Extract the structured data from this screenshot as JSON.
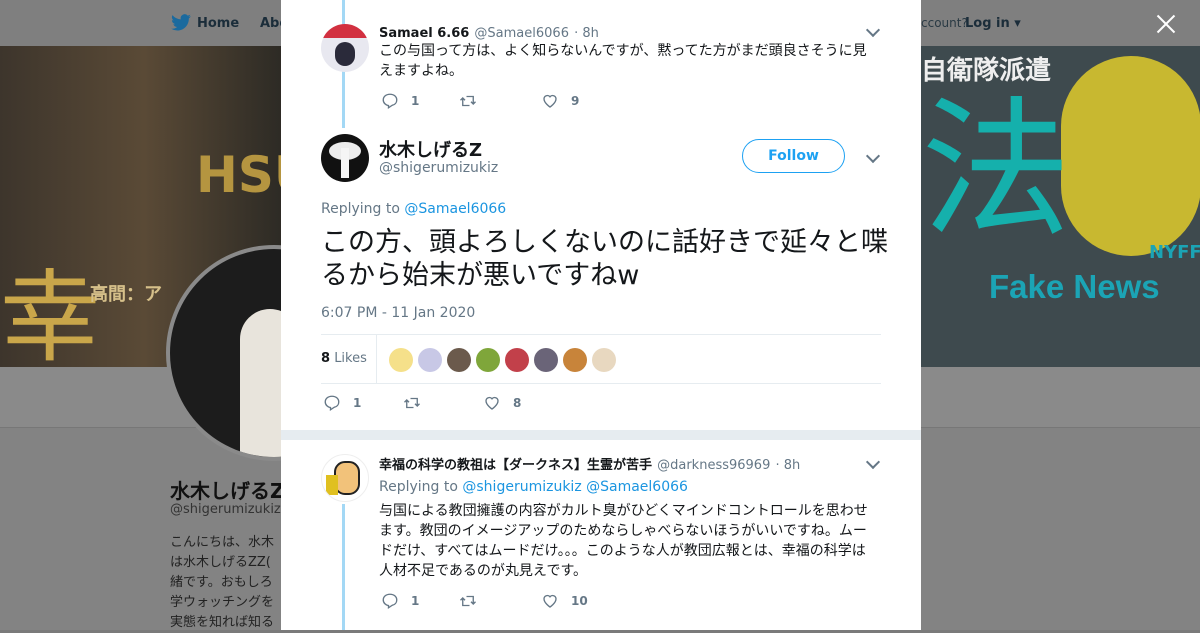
{
  "nav": {
    "home": "Home",
    "about": "Abo",
    "account_prompt": "ccount?",
    "login": "Log in"
  },
  "banner": {
    "left_caption": "高間：ア",
    "left_kanji": "幸",
    "left_latin": "HSU",
    "right_kanji": "法",
    "right_fake_news": "Fake News",
    "right_nyff": "NYFF",
    "right_title": "自衛隊派遣"
  },
  "profile": {
    "name": "水木しげるZ",
    "handle": "@shigerumizukiz",
    "bio": "こんにちは、水木\nは水木しげるZZ(\n緒です。おもしろ\n学ウォッチングを\n実態を知れば知る"
  },
  "tweets": {
    "prev": {
      "name": "Samael 6.66",
      "handle": "@Samael6066",
      "time": "· 8h",
      "text": "この与国って方は、よく知らないんですが、黙ってた方がまだ頭良さそうに見えますよね。",
      "reply_count": "1",
      "like_count": "9"
    },
    "main": {
      "name": "水木しげるZ",
      "handle": "@shigerumizukiz",
      "follow": "Follow",
      "replying_prefix": "Replying to",
      "replying_to": "@Samael6066",
      "text": "この方、頭よろしくないのに話好きで延々と喋るから始末が悪いですねw",
      "timestamp": "6:07 PM - 11 Jan 2020",
      "likes_count": "8",
      "likes_label": "Likes",
      "reply_count": "1",
      "like_count": "8"
    },
    "reply": {
      "name": "幸福の科学の教祖は【ダークネス】生霊が苦手",
      "handle": "@darkness96969",
      "time": "· 8h",
      "replying_prefix": "Replying to",
      "replying_to_1": "@shigerumizukiz",
      "replying_to_2": "@Samael6066",
      "text": "与国による教団擁護の内容がカルト臭がひどくマインドコントロールを思わせます。教団のイメージアップのためならしゃべらないほうがいいですね。ムードだけ、すべてはムードだけ。。。このような人が教団広報とは、幸福の科学は人材不足であるのが丸見えです。",
      "reply_count": "1",
      "like_count": "10"
    }
  },
  "colors": {
    "accent": "#1da1f2",
    "thread_line": "#a3d8f5",
    "muted": "#657786",
    "text": "#14171a",
    "like_avatar_colors": [
      "#f5e08a",
      "#c8c8e6",
      "#6b5a4c",
      "#7fa63a",
      "#c2404a",
      "#6a6478",
      "#c8843a",
      "#e8d8c0"
    ]
  }
}
